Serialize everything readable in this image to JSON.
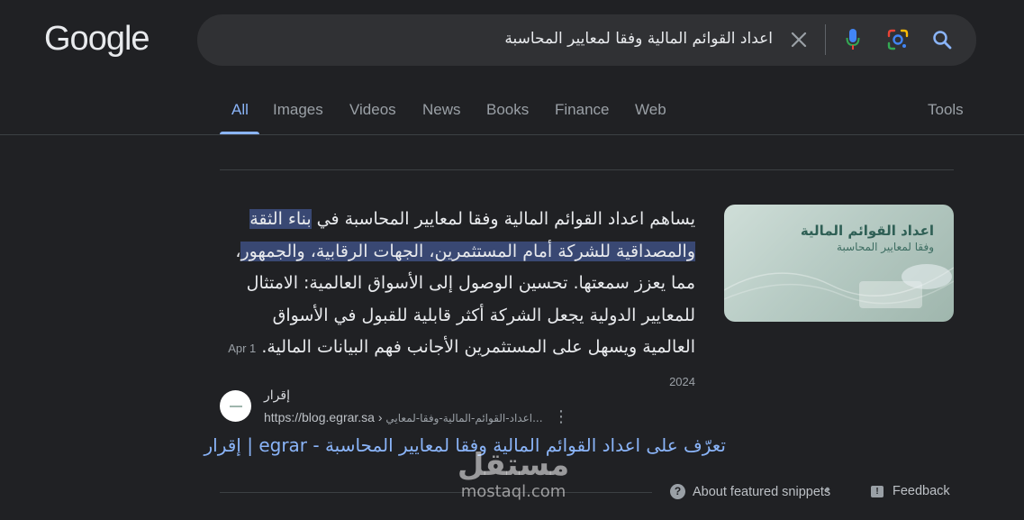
{
  "header": {
    "logo": "Google",
    "search": {
      "query": "اعداد القوائم المالية وفقا لمعايير المحاسبة"
    }
  },
  "tabs": {
    "items": [
      "All",
      "Images",
      "Videos",
      "News",
      "Books",
      "Finance",
      "Web"
    ],
    "active": "All",
    "tools_label": "Tools"
  },
  "snippet": {
    "pre": "يساهم اعداد القوائم المالية وفقا لمعايير المحاسبة في ",
    "highlight": "بناء الثقة والمصداقية للشركة أمام المستثمرين، الجهات الرقابية، والجمهور",
    "post": "، مما يعزز سمعتها. تحسين الوصول إلى الأسواق العالمية: الامتثال للمعايير الدولية يجعل الشركة أكثر قابلية للقبول في الأسواق العالمية ويسهل على المستثمرين الأجانب فهم البيانات المالية.",
    "date": "1 Apr 2024",
    "thumbnail": {
      "title": "اعداد القوائم المالية",
      "subtitle": "وفقا لمعايير المحاسبة"
    }
  },
  "source": {
    "site_name": "إقرار",
    "url_base": "https://blog.egrar.sa",
    "url_separator": " › ",
    "url_path": "اعداد-القوائم-المالية-وفقا-لمعايي...",
    "title": "تعرّف على اعداد القوائم المالية وفقا لمعايير المحاسبة - egrar | إقرار"
  },
  "footer": {
    "about_label": "About featured snippets",
    "separator": "•",
    "feedback_label": "Feedback"
  },
  "watermark": {
    "arabic": "مستقل",
    "latin": "mostaql.com"
  },
  "colors": {
    "background": "#202124",
    "search_box": "#303134",
    "link": "#8ab4f8",
    "highlight": "#394873",
    "mic_blue": "#4285f4",
    "mic_red": "#ea4335"
  },
  "icons": [
    "clear-icon",
    "microphone-icon",
    "google-lens-icon",
    "search-icon",
    "more-vert-icon",
    "info-icon",
    "feedback-icon"
  ]
}
